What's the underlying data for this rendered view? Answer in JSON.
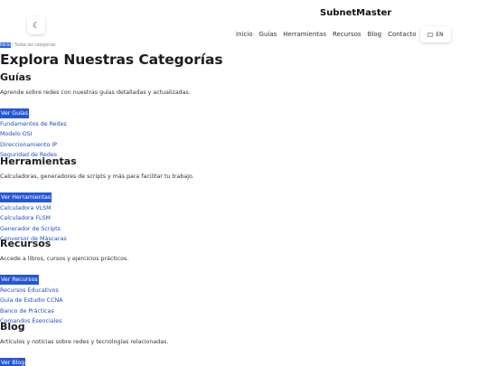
{
  "header": {
    "brand": "SubnetMaster",
    "theme_icon": "moon-icon",
    "nav": [
      "Inicio",
      "Guías",
      "Herramientas",
      "Recursos",
      "Blog",
      "Contacto"
    ],
    "lang_label": "EN",
    "lang_icon": "flag-icon"
  },
  "breadcrumb": {
    "current": "Inicio",
    "rest": "/ Todas las categorías"
  },
  "page_title": "Explora Nuestras Categorías",
  "sections": [
    {
      "title": "Guías",
      "description": "Aprende sobre redes con nuestras guías detalladas y actualizadas.",
      "cta": "Ver Guías",
      "links": [
        "Fundamentos de Redes",
        "Modelo OSI",
        "Direccionamiento IP",
        "Seguridad de Redes"
      ]
    },
    {
      "title": "Herramientas",
      "description": "Calculadoras, generadores de scripts y más para facilitar tu trabajo.",
      "cta": "Ver Herramientas",
      "links": [
        "Calculadora VLSM",
        "Calculadora FLSM",
        "Generador de Scripts",
        "Conversor de Máscaras"
      ]
    },
    {
      "title": "Recursos",
      "description": "Accede a libros, cursos y ejercicios prácticos.",
      "cta": "Ver Recursos",
      "links": [
        "Recursos Educativos",
        "Guía de Estudio CCNA",
        "Banco de Prácticas",
        "Comandos Esenciales"
      ]
    },
    {
      "title": "Blog",
      "description": "Artículos y noticias sobre redes y tecnologías relacionadas.",
      "cta": "Ver Blog",
      "links": []
    }
  ]
}
